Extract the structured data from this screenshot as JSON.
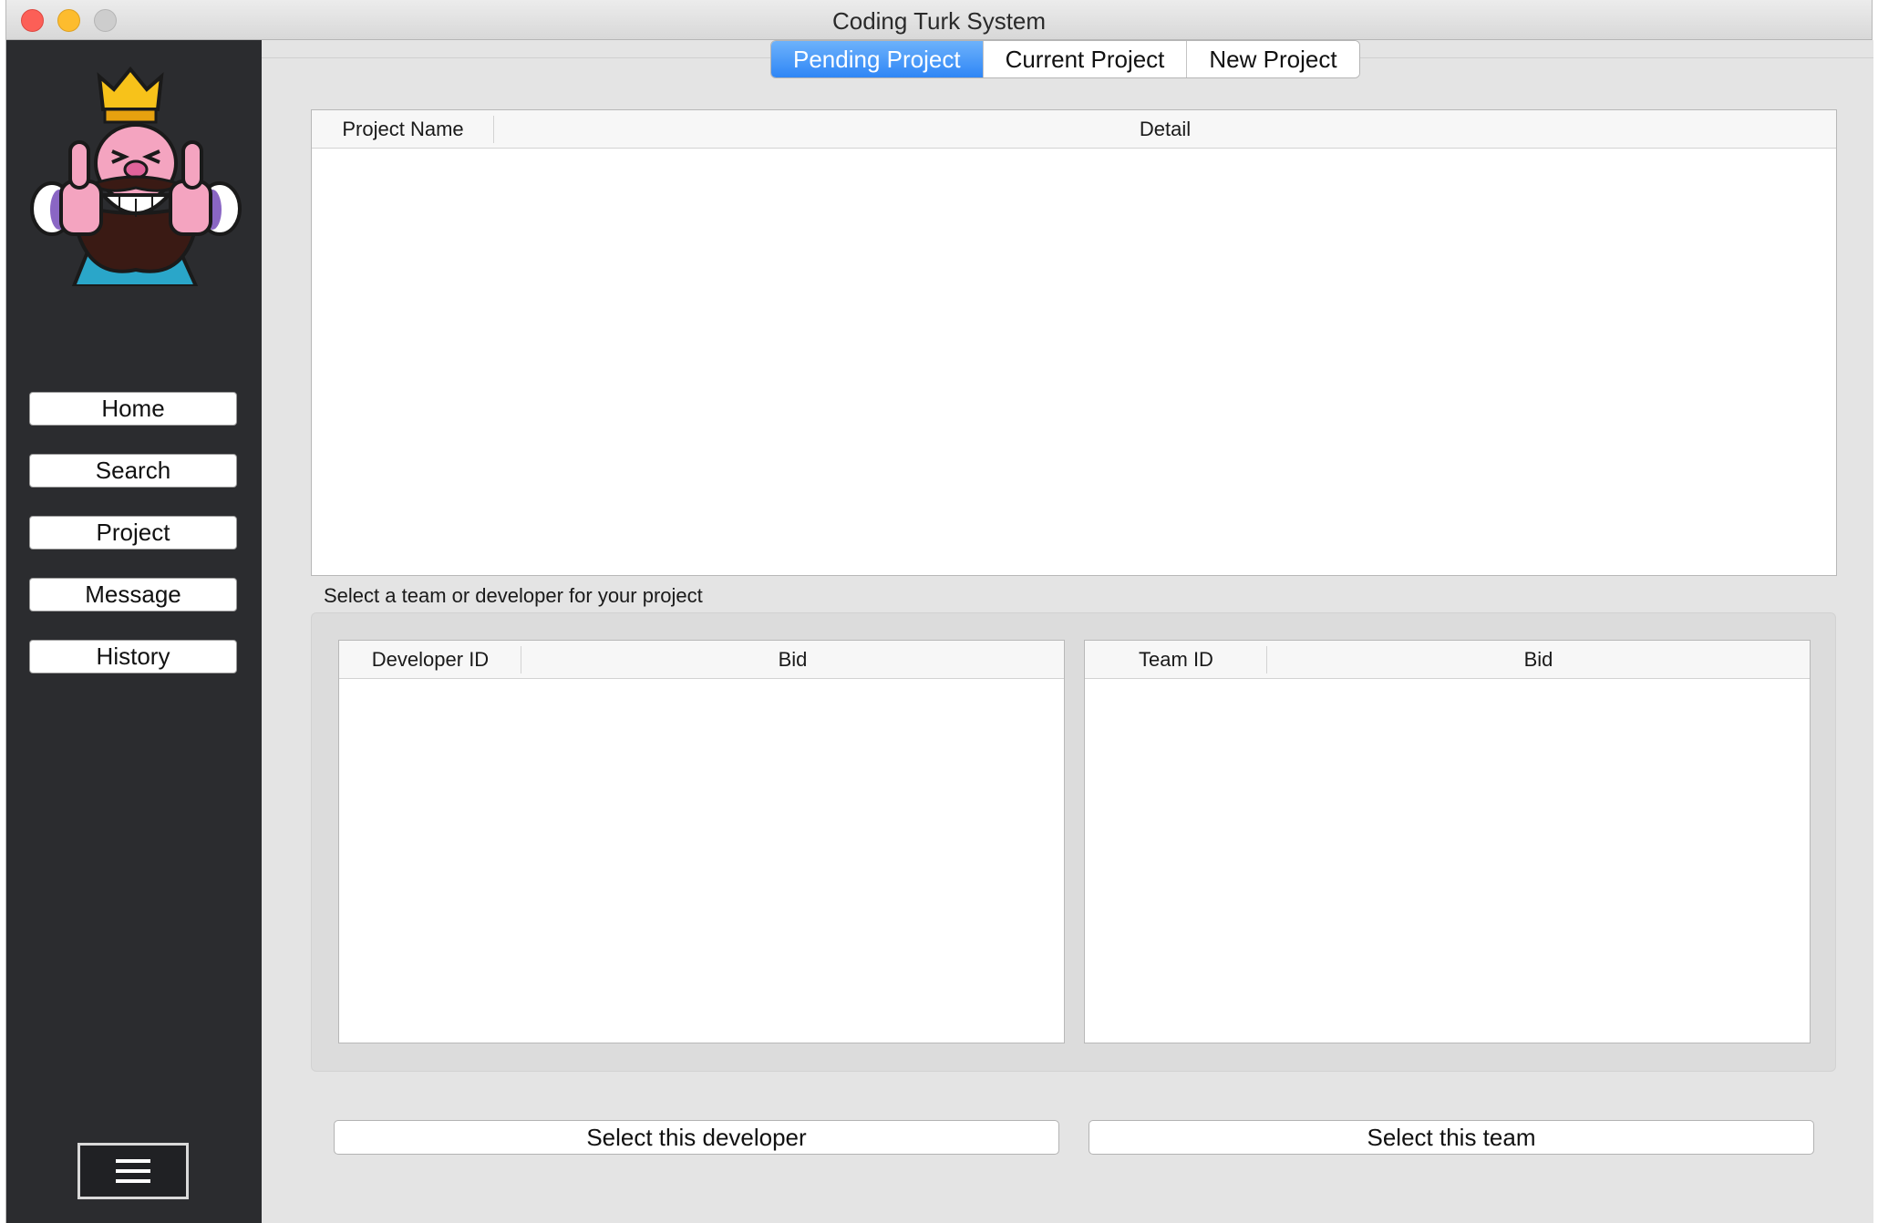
{
  "window": {
    "title": "Coding Turk System"
  },
  "sidebar": {
    "logo_icon": "king-thumbs-up-logo",
    "items": [
      {
        "label": "Home"
      },
      {
        "label": "Search"
      },
      {
        "label": "Project"
      },
      {
        "label": "Message"
      },
      {
        "label": "History"
      }
    ],
    "menu_icon": "hamburger-menu-icon"
  },
  "tabs": [
    {
      "label": "Pending Project",
      "active": true
    },
    {
      "label": "Current Project",
      "active": false
    },
    {
      "label": "New Project",
      "active": false
    }
  ],
  "projects_table": {
    "columns": [
      "Project Name",
      "Detail"
    ],
    "rows": []
  },
  "selection": {
    "label": "Select a team or developer for your project",
    "developers_table": {
      "columns": [
        "Developer ID",
        "Bid"
      ],
      "rows": []
    },
    "teams_table": {
      "columns": [
        "Team ID",
        "Bid"
      ],
      "rows": []
    },
    "select_developer_label": "Select this developer",
    "select_team_label": "Select this team"
  },
  "colors": {
    "sidebar_bg": "#2b2c2f",
    "tab_active": "#2f86f6",
    "window_bg": "#e4e4e4"
  }
}
